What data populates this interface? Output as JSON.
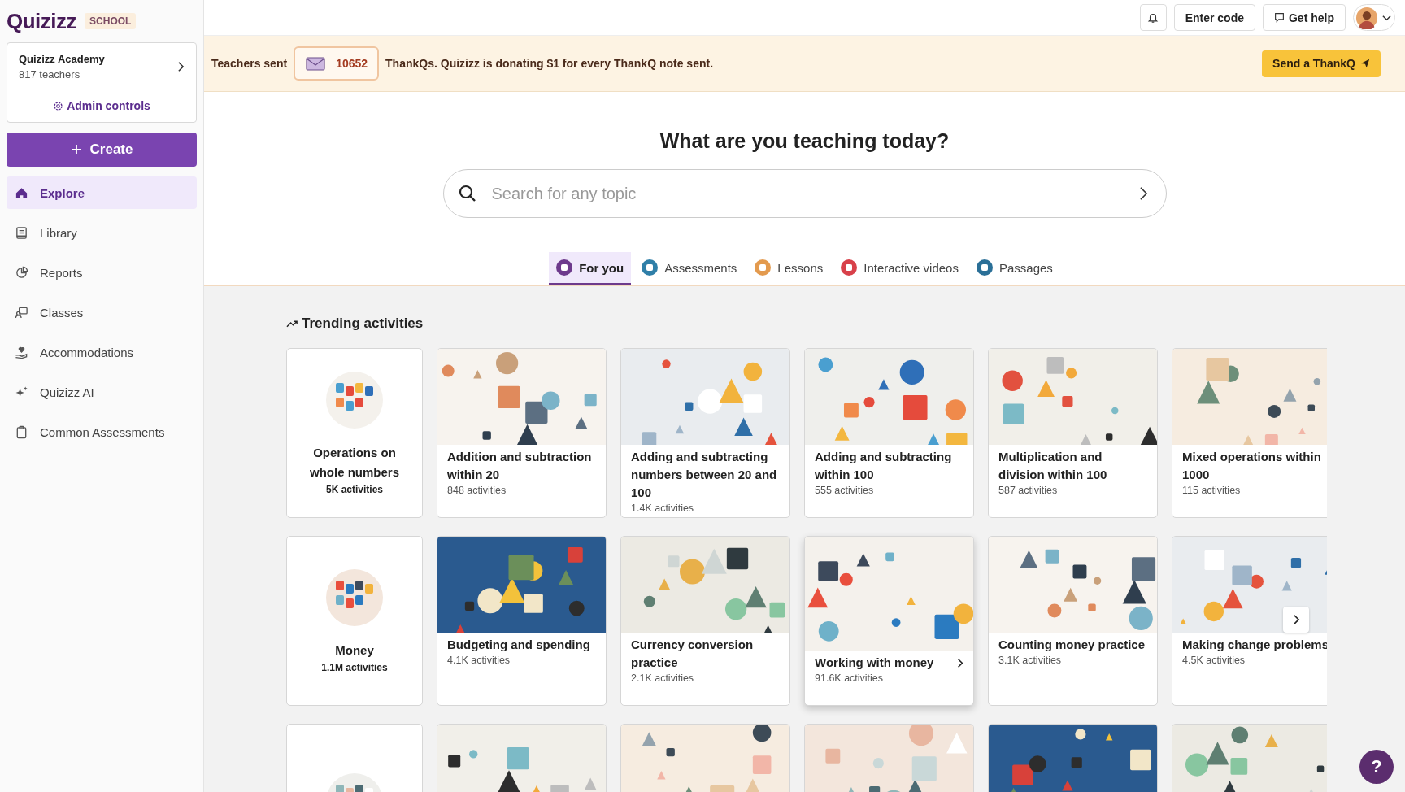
{
  "sidebar": {
    "logo": "Quizizz",
    "plan_badge": "SCHOOL",
    "org": {
      "name": "Quizizz Academy",
      "members": "817 teachers",
      "admin_link": "Admin controls"
    },
    "create_button": "Create",
    "items": [
      {
        "label": "Explore",
        "selected": true
      },
      {
        "label": "Library",
        "selected": false
      },
      {
        "label": "Reports",
        "selected": false
      },
      {
        "label": "Classes",
        "selected": false
      },
      {
        "label": "Accommodations",
        "selected": false
      },
      {
        "label": "Quizizz AI",
        "selected": false
      },
      {
        "label": "Common Assessments",
        "selected": false
      }
    ]
  },
  "top_bar": {
    "buttons": [
      "Enter code",
      "Get help"
    ]
  },
  "banner": {
    "lead": "Teachers sent",
    "count": "10652",
    "message": "ThankQs. Quizizz is donating $1 for every ThankQ note sent.",
    "action": "Send a ThankQ"
  },
  "heading": "What are you teaching today?",
  "search": {
    "placeholder": "Search for any topic"
  },
  "tabs": [
    {
      "label": "For you",
      "color": "#6d3a8c",
      "selected": true
    },
    {
      "label": "Assessments",
      "color": "#2f7fa8",
      "selected": false
    },
    {
      "label": "Lessons",
      "color": "#e39a4e",
      "selected": false
    },
    {
      "label": "Interactive videos",
      "color": "#d8414a",
      "selected": false
    },
    {
      "label": "Passages",
      "color": "#2a6f97",
      "selected": false
    }
  ],
  "section_title": "Trending activities",
  "rows": [
    {
      "cards": [
        {
          "kind": "topic",
          "title": "Operations on whole numbers",
          "count": "5K activities",
          "hovered": false
        },
        {
          "kind": "activity",
          "title": "Addition and subtraction within 20",
          "count": "848 activities",
          "hovered": false
        },
        {
          "kind": "activity",
          "title": "Adding and subtracting numbers between 20 and 100",
          "count": "1.4K activities",
          "hovered": false
        },
        {
          "kind": "activity",
          "title": "Adding and subtracting within 100",
          "count": "555 activities",
          "hovered": false
        },
        {
          "kind": "activity",
          "title": "Multiplication and division within 100",
          "count": "587 activities",
          "hovered": false
        },
        {
          "kind": "activity",
          "title": "Mixed operations within 1000",
          "count": "115 activities",
          "hovered": false
        }
      ]
    },
    {
      "cards": [
        {
          "kind": "topic",
          "title": "Money",
          "count": "1.1M activities",
          "hovered": false
        },
        {
          "kind": "activity",
          "title": "Budgeting and spending",
          "count": "4.1K activities",
          "hovered": false
        },
        {
          "kind": "activity",
          "title": "Currency conversion practice",
          "count": "2.1K activities",
          "hovered": false
        },
        {
          "kind": "activity",
          "title": "Working with money",
          "count": "91.6K activities",
          "hovered": true
        },
        {
          "kind": "activity",
          "title": "Counting money practice",
          "count": "3.1K activities",
          "hovered": false
        },
        {
          "kind": "activity",
          "title": "Making change problems",
          "count": "4.5K activities",
          "hovered": false
        }
      ]
    },
    {
      "cards": [
        {
          "kind": "topic"
        },
        {
          "kind": "activity"
        },
        {
          "kind": "activity"
        },
        {
          "kind": "activity"
        },
        {
          "kind": "activity"
        },
        {
          "kind": "activity"
        }
      ]
    }
  ],
  "help_button": "?"
}
